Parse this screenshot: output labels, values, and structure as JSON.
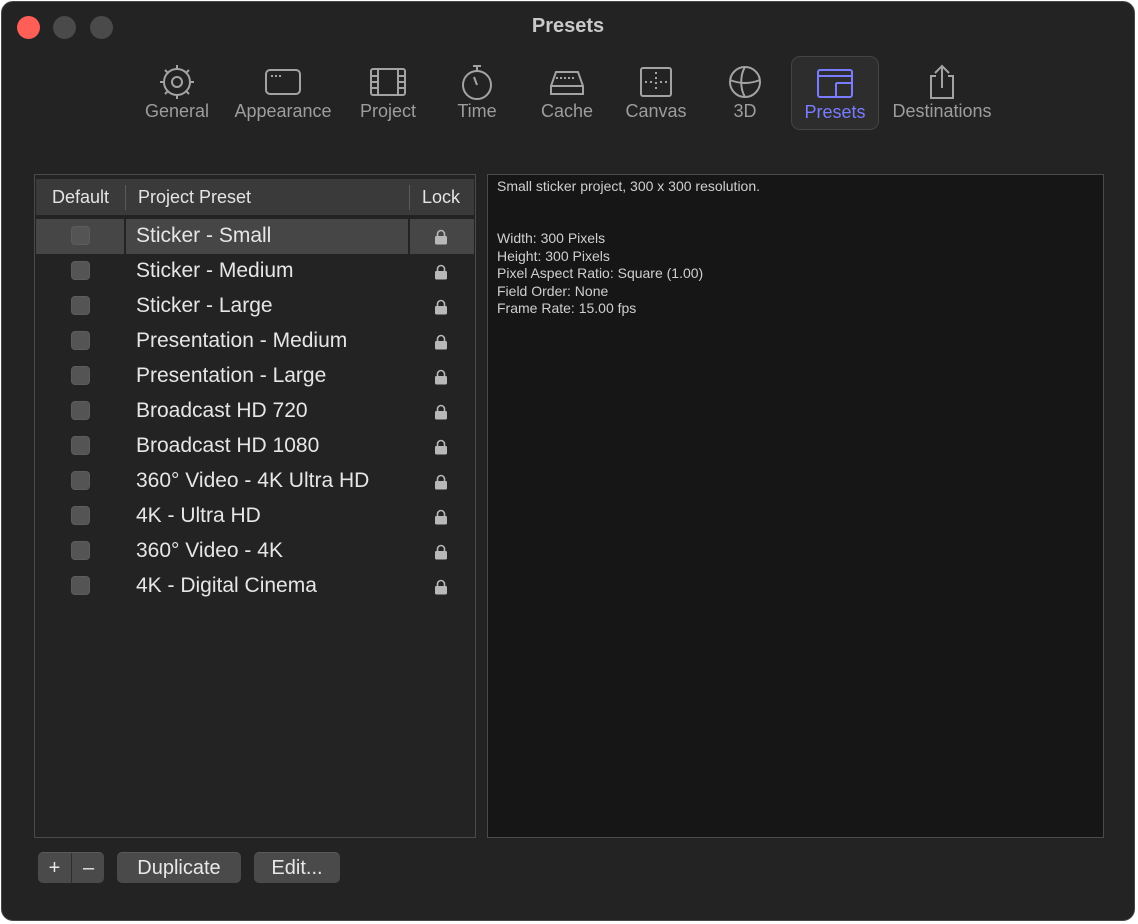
{
  "window": {
    "title": "Presets"
  },
  "toolbar": {
    "items": [
      {
        "label": "General",
        "icon": "gear-icon"
      },
      {
        "label": "Appearance",
        "icon": "window-icon"
      },
      {
        "label": "Project",
        "icon": "film-icon"
      },
      {
        "label": "Time",
        "icon": "stopwatch-icon"
      },
      {
        "label": "Cache",
        "icon": "drive-icon"
      },
      {
        "label": "Canvas",
        "icon": "canvas-icon"
      },
      {
        "label": "3D",
        "icon": "globe-icon"
      },
      {
        "label": "Presets",
        "icon": "presets-icon",
        "selected": true
      },
      {
        "label": "Destinations",
        "icon": "share-icon"
      }
    ],
    "accent": "#7a7cff"
  },
  "table": {
    "headers": {
      "default": "Default",
      "preset": "Project Preset",
      "lock": "Lock"
    },
    "rows": [
      {
        "name": "Sticker - Small",
        "selected": true
      },
      {
        "name": "Sticker - Medium"
      },
      {
        "name": "Sticker - Large"
      },
      {
        "name": "Presentation - Medium"
      },
      {
        "name": "Presentation - Large"
      },
      {
        "name": "Broadcast HD 720"
      },
      {
        "name": "Broadcast HD 1080"
      },
      {
        "name": "360° Video - 4K Ultra HD"
      },
      {
        "name": "4K - Ultra HD"
      },
      {
        "name": "360° Video - 4K"
      },
      {
        "name": "4K - Digital Cinema"
      }
    ]
  },
  "description": {
    "summary": "Small sticker project, 300 x 300 resolution.",
    "lines": [
      "Width: 300 Pixels",
      "Height: 300 Pixels",
      "Pixel Aspect Ratio: Square (1.00)",
      "Field Order: None",
      "Frame Rate: 15.00 fps"
    ]
  },
  "buttons": {
    "add": "+",
    "remove": "–",
    "duplicate": "Duplicate",
    "edit": "Edit..."
  }
}
